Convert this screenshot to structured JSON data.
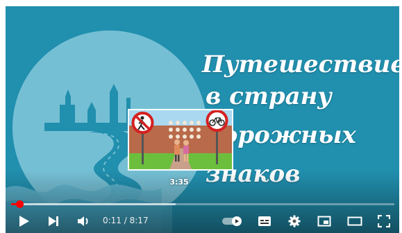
{
  "video": {
    "title_lines": [
      "Путешествие",
      "в страну",
      "дорожных",
      "знаков"
    ]
  },
  "preview": {
    "time": "3:35"
  },
  "player": {
    "current_time": "0:11",
    "separator": " / ",
    "duration": "8:17",
    "progress_fraction": 0.022,
    "buffered_fraction": 0.43
  },
  "icons": {
    "play": "play-icon",
    "next": "next-icon",
    "volume": "volume-icon",
    "autoplay": "autoplay-toggle-icon",
    "subtitles": "subtitles-icon",
    "settings": "gear-icon",
    "miniplayer": "miniplayer-icon",
    "theater": "theater-mode-icon",
    "fullscreen": "fullscreen-icon"
  },
  "colors": {
    "background": "#218fae",
    "accent": "#ff0000",
    "text": "#ffffff"
  }
}
